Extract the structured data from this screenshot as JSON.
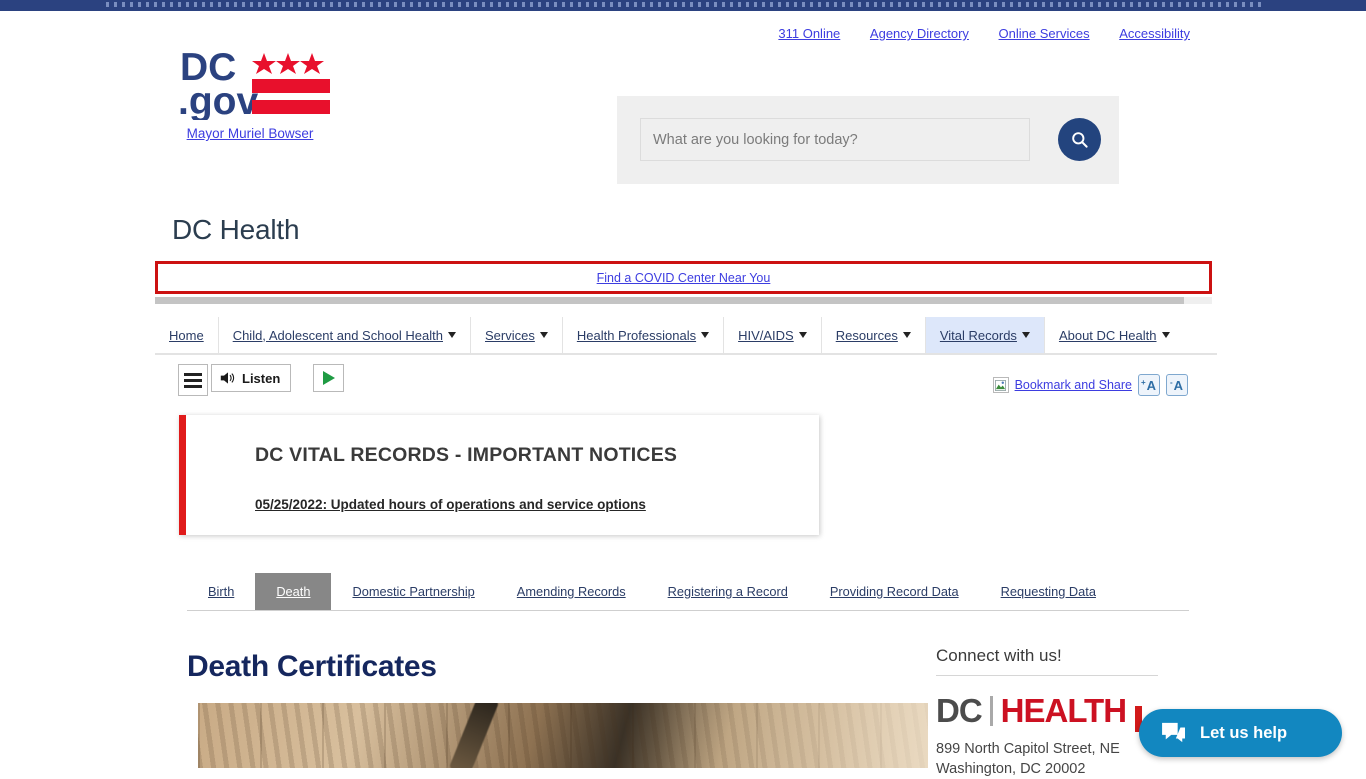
{
  "topbar": {
    "name": "dc-gov-blue-bar"
  },
  "utility_links": [
    {
      "label": "311 Online"
    },
    {
      "label": "Agency Directory"
    },
    {
      "label": "Online Services"
    },
    {
      "label": "Accessibility"
    }
  ],
  "logo": {
    "dc_text": "DC",
    "gov_text": ".gov",
    "mayor_link": "Mayor Muriel Bowser"
  },
  "search": {
    "placeholder": "What are you looking for today?",
    "value": "",
    "button_icon": "search-icon",
    "panel_bg": "#efefef",
    "button_bg": "#23447e"
  },
  "agency": {
    "title": "DC Health"
  },
  "covid_alert": {
    "link_label": "Find a COVID Center Near You",
    "border_color": "#cc1111"
  },
  "main_nav": {
    "items": [
      {
        "label": "Home",
        "has_caret": false,
        "active": false
      },
      {
        "label": "Child, Adolescent and School Health",
        "has_caret": true,
        "active": false
      },
      {
        "label": "Services",
        "has_caret": true,
        "active": false
      },
      {
        "label": "Health Professionals",
        "has_caret": true,
        "active": false
      },
      {
        "label": "HIV/AIDS",
        "has_caret": true,
        "active": false
      },
      {
        "label": "Resources",
        "has_caret": true,
        "active": false
      },
      {
        "label": "Vital Records",
        "has_caret": true,
        "active": true
      },
      {
        "label": "About DC Health",
        "has_caret": true,
        "active": false
      }
    ],
    "active_bg": "#dde7fa"
  },
  "toolbar": {
    "menu_icon": "hamburger-icon",
    "listen_label": "Listen",
    "speaker_icon": "speaker-icon",
    "play_icon": "play-icon",
    "share_label": "Bookmark and Share",
    "font_increase_label": "A",
    "font_decrease_label": "A"
  },
  "notice": {
    "title": "DC VITAL RECORDS - IMPORTANT NOTICES",
    "link": "05/25/2022: Updated hours of operations and service options",
    "accent_color": "#e01b1b"
  },
  "sub_tabs": {
    "items": [
      {
        "label": "Birth",
        "active": false
      },
      {
        "label": "Death",
        "active": true
      },
      {
        "label": "Domestic Partnership",
        "active": false
      },
      {
        "label": "Amending Records",
        "active": false
      },
      {
        "label": "Registering a Record",
        "active": false
      },
      {
        "label": "Providing Record Data",
        "active": false
      },
      {
        "label": "Requesting Data",
        "active": false
      }
    ],
    "active_bg": "#878787"
  },
  "main": {
    "heading": "Death Certificates",
    "hero_image_alt": "last-will-and-testament-document-with-pen"
  },
  "rail": {
    "title": "Connect with us!",
    "logo_dc": "DC",
    "logo_health": "HEALTH",
    "address_line1": "899 North Capitol Street, NE",
    "address_line2": "Washington, DC 20002"
  },
  "chat": {
    "label": "Let us help",
    "icon": "chat-bubble-icon",
    "bg": "#1287c0"
  }
}
